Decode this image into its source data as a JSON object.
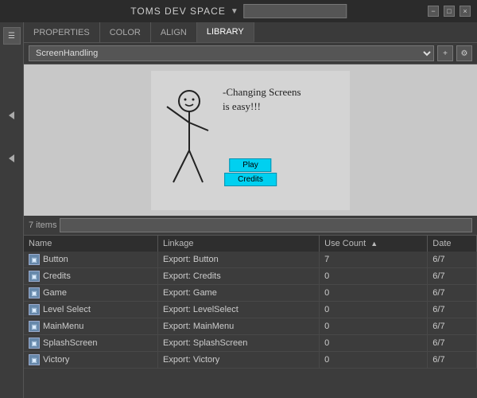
{
  "titlebar": {
    "title": "TOMS DEV SPACE",
    "search_placeholder": "",
    "btn_minimize": "−",
    "btn_restore": "□",
    "btn_close": "×"
  },
  "tabs": [
    {
      "label": "PROPERTIES",
      "active": false
    },
    {
      "label": "COLOR",
      "active": false
    },
    {
      "label": "ALIGN",
      "active": false
    },
    {
      "label": "LIBRARY",
      "active": true
    }
  ],
  "library": {
    "select_value": "ScreenHandling",
    "item_count": "7 items",
    "search_placeholder": "",
    "columns": [
      {
        "label": "Name",
        "key": "name"
      },
      {
        "label": "Linkage",
        "key": "linkage"
      },
      {
        "label": "Use Count",
        "key": "use_count"
      },
      {
        "label": "Date",
        "key": "date"
      }
    ],
    "items": [
      {
        "name": "Button",
        "linkage": "Export: Button",
        "use_count": "7",
        "date": "6/7"
      },
      {
        "name": "Credits",
        "linkage": "Export: Credits",
        "use_count": "0",
        "date": "6/7"
      },
      {
        "name": "Game",
        "linkage": "Export: Game",
        "use_count": "0",
        "date": "6/7"
      },
      {
        "name": "Level Select",
        "linkage": "Export: LevelSelect",
        "use_count": "0",
        "date": "6/7"
      },
      {
        "name": "MainMenu",
        "linkage": "Export: MainMenu",
        "use_count": "0",
        "date": "6/7"
      },
      {
        "name": "SplashScreen",
        "linkage": "Export: SplashScreen",
        "use_count": "0",
        "date": "6/7"
      },
      {
        "name": "Victory",
        "linkage": "Export: Victory",
        "use_count": "0",
        "date": "6/7"
      }
    ]
  },
  "preview": {
    "sketch_line1": "-Changing Screens",
    "sketch_line2": "is easy!!!",
    "btn_play": "Play",
    "btn_credits": "Credits"
  }
}
